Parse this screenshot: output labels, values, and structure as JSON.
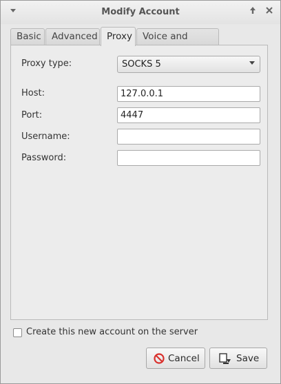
{
  "window": {
    "title": "Modify Account"
  },
  "titlebar": {
    "menu_icon": "chevron-down-icon",
    "pin_icon": "up-arrow-icon",
    "close_icon": "close-icon"
  },
  "tabs": [
    {
      "label": "Basic",
      "active": false
    },
    {
      "label": "Advanced",
      "active": false
    },
    {
      "label": "Proxy",
      "active": true
    },
    {
      "label": "Voice and Video",
      "active": false
    }
  ],
  "proxy": {
    "type_label": "Proxy type:",
    "type_value": "SOCKS 5",
    "host_label": "Host:",
    "host_value": "127.0.0.1",
    "port_label": "Port:",
    "port_value": "4447",
    "username_label": "Username:",
    "username_value": "",
    "password_label": "Password:",
    "password_value": ""
  },
  "create_on_server": {
    "label": "Create this new account on the server",
    "checked": false
  },
  "buttons": {
    "cancel_label": "Cancel",
    "save_label": "Save"
  },
  "colors": {
    "cancel_icon": "#d9302c",
    "background": "#2a5a86"
  }
}
